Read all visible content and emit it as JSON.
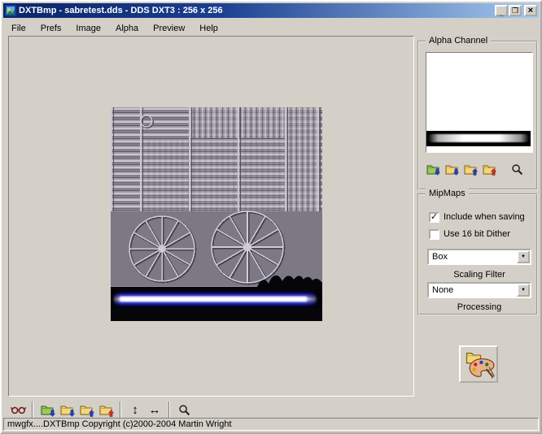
{
  "window": {
    "title": "DXTBmp - sabretest.dds - DDS DXT3 : 256 x 256",
    "minimize_glyph": "_",
    "maximize_glyph": "❐",
    "close_glyph": "×"
  },
  "menu": {
    "items": [
      "File",
      "Prefs",
      "Image",
      "Alpha",
      "Preview",
      "Help"
    ]
  },
  "alpha_panel": {
    "title": "Alpha Channel"
  },
  "mipmaps_panel": {
    "title": "MipMaps",
    "include_when_saving": {
      "label": "Include when saving",
      "checked": true
    },
    "use_16bit_dither": {
      "label": "Use 16 bit Dither",
      "checked": false
    },
    "scaling_filter": {
      "value": "Box",
      "label": "Scaling Filter"
    },
    "processing": {
      "value": "None",
      "label": "Processing"
    }
  },
  "editor_button": {
    "badge": "?"
  },
  "statusbar": {
    "text": "mwgfx....DXTBmp Copyright (c)2000-2004 Martin Wright"
  },
  "glyphs": {
    "check": "✓",
    "dropdown_arrow": "▼",
    "flip_vertical": "↕",
    "flip_horizontal": "↔"
  },
  "colors": {
    "window_bg": "#d4d0c8",
    "titlebar_start": "#0a246a",
    "titlebar_end": "#a6caf0",
    "glow_blue": "#2020c0"
  }
}
